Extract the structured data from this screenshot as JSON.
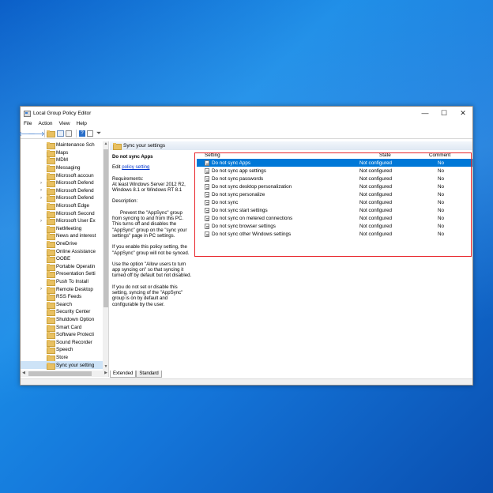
{
  "window": {
    "title": "Local Group Policy Editor",
    "controls": {
      "minimize": "—",
      "maximize": "☐",
      "close": "✕"
    }
  },
  "menu": [
    "File",
    "Action",
    "View",
    "Help"
  ],
  "toolbar": {
    "icons": [
      "back-icon",
      "forward-icon",
      "up-icon",
      "show-hide-tree-icon",
      "export-list-icon",
      "help-icon",
      "properties-icon",
      "filter-icon"
    ]
  },
  "tree": {
    "items": [
      {
        "label": "Maintenance Sch",
        "expander": ""
      },
      {
        "label": "Maps",
        "expander": ""
      },
      {
        "label": "MDM",
        "expander": ""
      },
      {
        "label": "Messaging",
        "expander": ""
      },
      {
        "label": "Microsoft accoun",
        "expander": ""
      },
      {
        "label": "Microsoft Defend",
        "expander": "›"
      },
      {
        "label": "Microsoft Defend",
        "expander": "›"
      },
      {
        "label": "Microsoft Defend",
        "expander": "›"
      },
      {
        "label": "Microsoft Edge",
        "expander": ""
      },
      {
        "label": "Microsoft Second",
        "expander": ""
      },
      {
        "label": "Microsoft User Ex",
        "expander": "›"
      },
      {
        "label": "NetMeeting",
        "expander": ""
      },
      {
        "label": "News and interest",
        "expander": ""
      },
      {
        "label": "OneDrive",
        "expander": ""
      },
      {
        "label": "Online Assistance",
        "expander": ""
      },
      {
        "label": "OOBE",
        "expander": ""
      },
      {
        "label": "Portable Operatin",
        "expander": ""
      },
      {
        "label": "Presentation Setti",
        "expander": ""
      },
      {
        "label": "Push To Install",
        "expander": ""
      },
      {
        "label": "Remote Desktop ",
        "expander": "›"
      },
      {
        "label": "RSS Feeds",
        "expander": ""
      },
      {
        "label": "Search",
        "expander": ""
      },
      {
        "label": "Security Center",
        "expander": ""
      },
      {
        "label": "Shutdown Option",
        "expander": ""
      },
      {
        "label": "Smart Card",
        "expander": ""
      },
      {
        "label": "Software Protecti",
        "expander": ""
      },
      {
        "label": "Sound Recorder",
        "expander": ""
      },
      {
        "label": "Speech",
        "expander": ""
      },
      {
        "label": "Store",
        "expander": ""
      },
      {
        "label": "Sync your setting",
        "expander": "",
        "selected": true
      }
    ]
  },
  "pane": {
    "header": "Sync your settings",
    "description": {
      "title": "Do not sync Apps",
      "edit_prefix": "Edit",
      "edit_link": "policy setting",
      "requirements_label": "Requirements:",
      "requirements_text": "At least Windows Server 2012 R2, Windows 8.1 or Windows RT 8.1",
      "description_label": "Description:",
      "p1": "Prevent the \"AppSync\" group from syncing to and from this PC. This turns off and disables the \"AppSync\" group on the \"sync your settings\" page in PC settings.",
      "p2": "If you enable this policy setting, the \"AppSync\" group will not be synced.",
      "p3": "Use the option \"Allow users to turn app syncing on\" so that syncing it turned off by default but not disabled.",
      "p4": "If you do not set or disable this setting, syncing of the \"AppSync\" group is on by default and configurable by the user."
    },
    "columns": {
      "setting": "Setting",
      "state": "State",
      "comment": "Comment"
    },
    "rows": [
      {
        "name": "Do not sync Apps",
        "state": "Not configured",
        "comment": "No",
        "selected": true
      },
      {
        "name": "Do not sync app settings",
        "state": "Not configured",
        "comment": "No"
      },
      {
        "name": "Do not sync passwords",
        "state": "Not configured",
        "comment": "No"
      },
      {
        "name": "Do not sync desktop personalization",
        "state": "Not configured",
        "comment": "No"
      },
      {
        "name": "Do not sync personalize",
        "state": "Not configured",
        "comment": "No"
      },
      {
        "name": "Do not sync",
        "state": "Not configured",
        "comment": "No"
      },
      {
        "name": "Do not sync start settings",
        "state": "Not configured",
        "comment": "No"
      },
      {
        "name": "Do not sync on metered connections",
        "state": "Not configured",
        "comment": "No"
      },
      {
        "name": "Do not sync browser settings",
        "state": "Not configured",
        "comment": "No"
      },
      {
        "name": "Do not sync other Windows settings",
        "state": "Not configured",
        "comment": "No"
      }
    ],
    "tabs": [
      "Extended",
      "Standard"
    ]
  },
  "colors": {
    "highlight_box": "#e8262b",
    "selection": "#0078d7",
    "link": "#0033cc"
  }
}
